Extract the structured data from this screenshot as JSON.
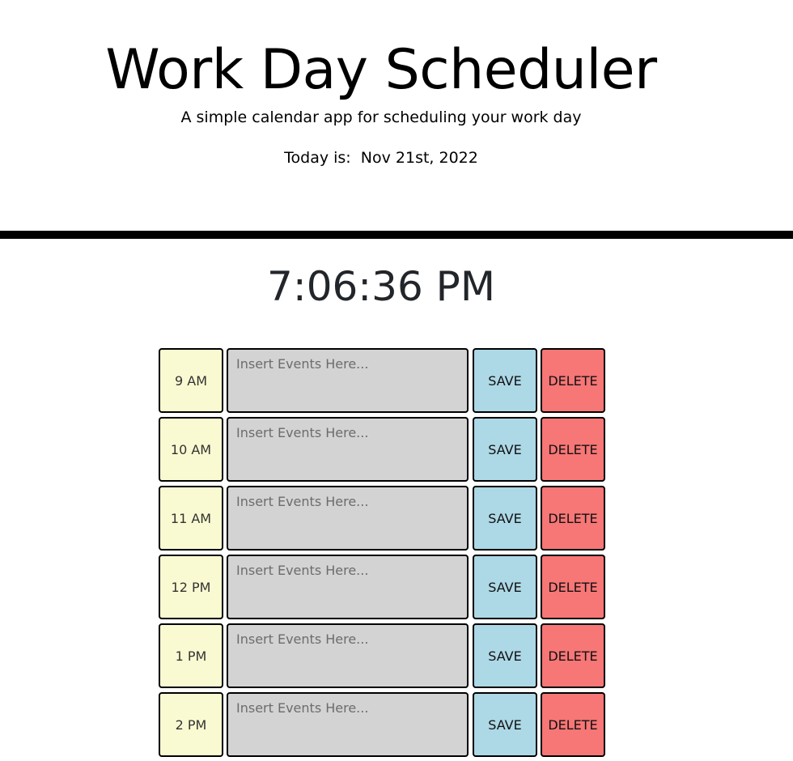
{
  "header": {
    "title": "Work Day Scheduler",
    "subtitle": "A simple calendar app for scheduling your work day",
    "today_label": "Today is:  Nov 21st, 2022"
  },
  "clock": {
    "time": "7:06:36 PM"
  },
  "schedule": {
    "rows": [
      {
        "hour": "9 AM",
        "placeholder": "Insert Events Here...",
        "save": "SAVE",
        "delete": "DELETE"
      },
      {
        "hour": "10 AM",
        "placeholder": "Insert Events Here...",
        "save": "SAVE",
        "delete": "DELETE"
      },
      {
        "hour": "11 AM",
        "placeholder": "Insert Events Here...",
        "save": "SAVE",
        "delete": "DELETE"
      },
      {
        "hour": "12 PM",
        "placeholder": "Insert Events Here...",
        "save": "SAVE",
        "delete": "DELETE"
      },
      {
        "hour": "1 PM",
        "placeholder": "Insert Events Here...",
        "save": "SAVE",
        "delete": "DELETE"
      },
      {
        "hour": "2 PM",
        "placeholder": "Insert Events Here...",
        "save": "SAVE",
        "delete": "DELETE"
      }
    ]
  },
  "colors": {
    "hour_bg": "#fafad2",
    "event_bg": "#d3d3d3",
    "save_bg": "#add8e6",
    "delete_bg": "#f77676",
    "divider": "#000000"
  }
}
